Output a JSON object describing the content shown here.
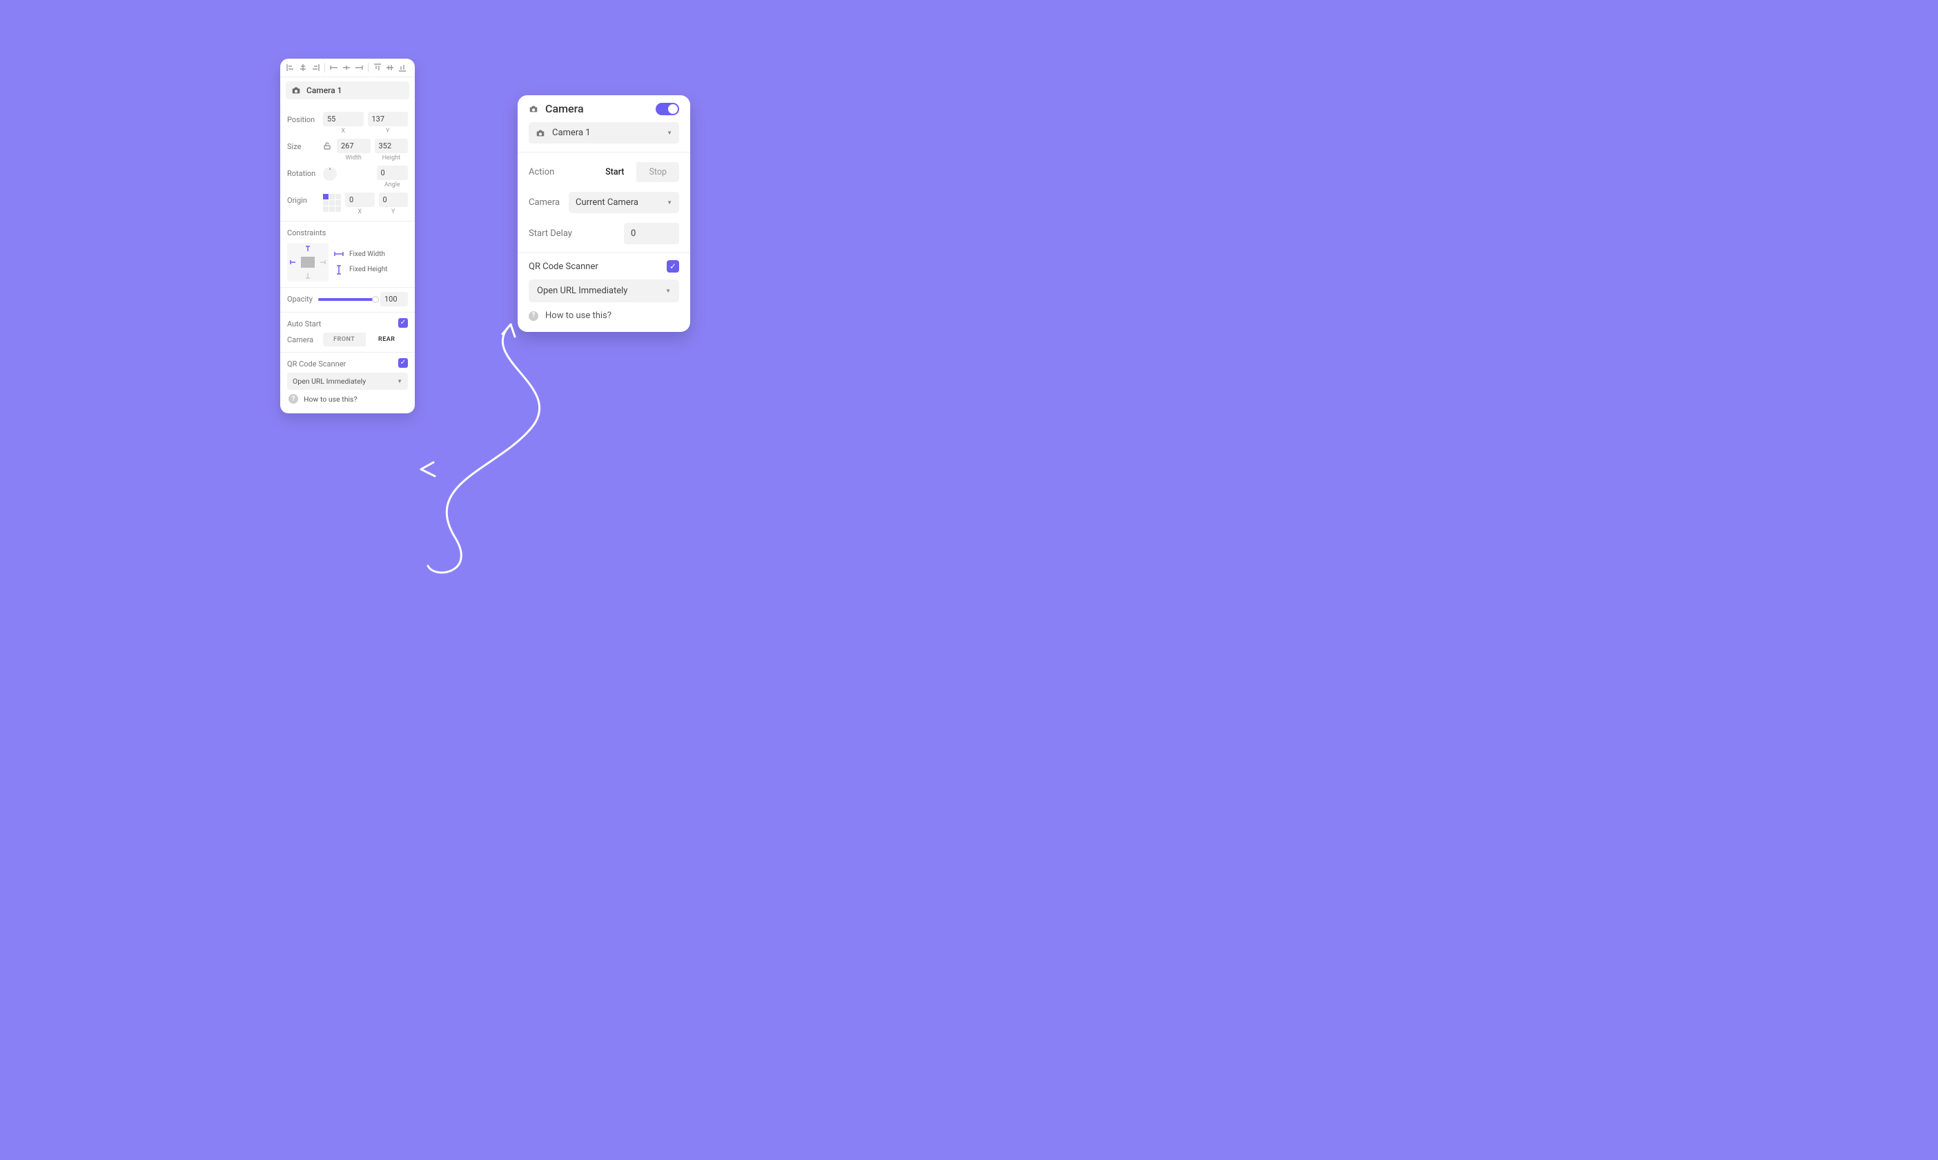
{
  "colors": {
    "accent": "#6b5ff0",
    "bg": "#8a80f5"
  },
  "leftPanel": {
    "title": "Camera 1",
    "position": {
      "label": "Position",
      "x": "55",
      "y": "137",
      "xLabel": "X",
      "yLabel": "Y"
    },
    "size": {
      "label": "Size",
      "w": "267",
      "h": "352",
      "wLabel": "Width",
      "hLabel": "Height"
    },
    "rotation": {
      "label": "Rotation",
      "angle": "0",
      "angleLabel": "Angle"
    },
    "origin": {
      "label": "Origin",
      "x": "0",
      "y": "0",
      "xLabel": "X",
      "yLabel": "Y"
    },
    "constraints": {
      "label": "Constraints",
      "fixedW": "Fixed Width",
      "fixedH": "Fixed Height"
    },
    "opacity": {
      "label": "Opacity",
      "value": "100"
    },
    "autoStart": {
      "label": "Auto Start",
      "checked": true
    },
    "camera": {
      "label": "Camera",
      "front": "FRONT",
      "rear": "REAR",
      "selected": "REAR"
    },
    "qr": {
      "label": "QR Code Scanner",
      "checked": true,
      "dropdown": "Open URL Immediately",
      "help": "How to use this?"
    }
  },
  "rightPanel": {
    "title": "Camera",
    "enabled": true,
    "selector": "Camera 1",
    "action": {
      "label": "Action",
      "start": "Start",
      "stop": "Stop",
      "selected": "Start"
    },
    "cameraSel": {
      "label": "Camera",
      "value": "Current Camera"
    },
    "startDelay": {
      "label": "Start Delay",
      "value": "0"
    },
    "qr": {
      "label": "QR Code Scanner",
      "checked": true,
      "dropdown": "Open URL Immediately",
      "help": "How to use this?"
    }
  }
}
